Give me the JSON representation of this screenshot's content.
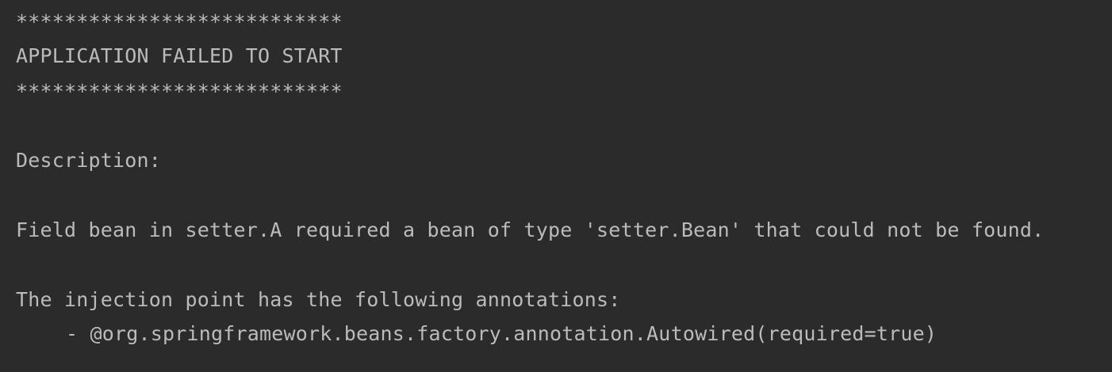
{
  "console": {
    "lines": [
      "***************************",
      "APPLICATION FAILED TO START",
      "***************************",
      "Description:",
      "Field bean in setter.A required a bean of type 'setter.Bean' that could not be found.",
      "The injection point has the following annotations:",
      "- @org.springframework.beans.factory.annotation.Autowired(required=true)"
    ]
  },
  "colors": {
    "background": "#2b2b2b",
    "text": "#bbbbbb"
  }
}
